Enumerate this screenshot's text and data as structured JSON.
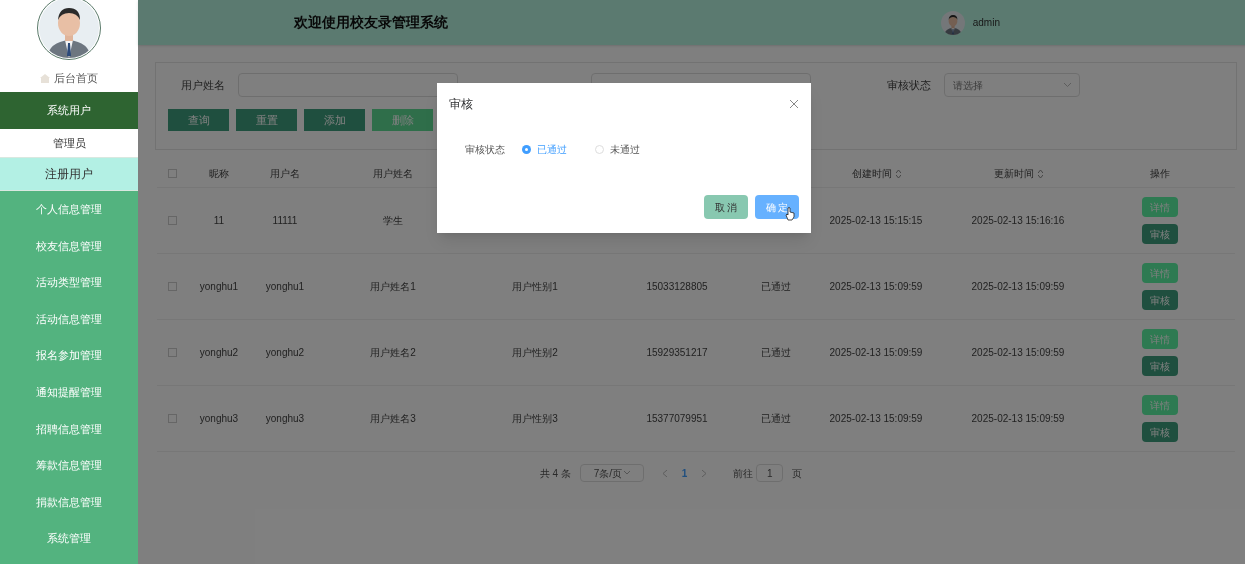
{
  "sidebar": {
    "home": "后台首页",
    "menu": [
      {
        "label": "系统用户",
        "expanded": true,
        "children": [
          {
            "label": "管理员",
            "selected": false
          },
          {
            "label": "注册用户",
            "selected": true
          }
        ]
      },
      {
        "label": "个人信息管理",
        "expanded": false
      },
      {
        "label": "校友信息管理",
        "expanded": false
      },
      {
        "label": "活动类型管理",
        "expanded": false
      },
      {
        "label": "活动信息管理",
        "expanded": false
      },
      {
        "label": "报名参加管理",
        "expanded": false
      },
      {
        "label": "通知提醒管理",
        "expanded": false
      },
      {
        "label": "招聘信息管理",
        "expanded": false
      },
      {
        "label": "筹款信息管理",
        "expanded": false
      },
      {
        "label": "捐款信息管理",
        "expanded": false
      },
      {
        "label": "系统管理",
        "expanded": false
      }
    ]
  },
  "header": {
    "title": "欢迎使用校友录管理系统",
    "user": "admin"
  },
  "filters": {
    "fields": [
      {
        "kind": "text",
        "label": "用户姓名"
      },
      {
        "kind": "text"
      },
      {
        "kind": "select",
        "label": "审核状态",
        "placeholder": "请选择"
      }
    ],
    "buttons": [
      {
        "label": "查询",
        "kind": "plain"
      },
      {
        "label": "重置",
        "kind": "plain"
      },
      {
        "label": "添加",
        "kind": "plain"
      },
      {
        "label": "删除",
        "kind": "danger"
      }
    ]
  },
  "table": {
    "all_checked": false,
    "columns": [
      {
        "label": "昵称"
      },
      {
        "label": "用户名"
      },
      {
        "label": "用户姓名"
      },
      {},
      {},
      {},
      {
        "label": "创建时间",
        "sortable": true
      },
      {
        "label": "更新时间",
        "sortable": true
      },
      {
        "label": "操作"
      }
    ],
    "rows": [
      {
        "checked": false,
        "cells": [
          {
            "text": "11"
          },
          {
            "text": "11111"
          },
          {
            "text": "学生"
          },
          {},
          {},
          {},
          {
            "text": "2025-02-13 15:15:15"
          },
          {
            "text": "2025-02-13 15:16:16"
          }
        ],
        "actions": [
          "详情",
          "审核"
        ]
      },
      {
        "checked": false,
        "cells": [
          {
            "text": "yonghu1"
          },
          {
            "text": "yonghu1"
          },
          {
            "text": "用户姓名1"
          },
          {
            "text": "用户性别1"
          },
          {
            "text": "15033128805"
          },
          {
            "text": "已通过"
          },
          {
            "text": "2025-02-13 15:09:59"
          },
          {
            "text": "2025-02-13 15:09:59"
          }
        ],
        "actions": [
          "详情",
          "审核"
        ]
      },
      {
        "checked": false,
        "cells": [
          {
            "text": "yonghu2"
          },
          {
            "text": "yonghu2"
          },
          {
            "text": "用户姓名2"
          },
          {
            "text": "用户性别2"
          },
          {
            "text": "15929351217"
          },
          {
            "text": "已通过"
          },
          {
            "text": "2025-02-13 15:09:59"
          },
          {
            "text": "2025-02-13 15:09:59"
          }
        ],
        "actions": [
          "详情",
          "审核"
        ]
      },
      {
        "checked": false,
        "cells": [
          {
            "text": "yonghu3"
          },
          {
            "text": "yonghu3"
          },
          {
            "text": "用户姓名3"
          },
          {
            "text": "用户性别3"
          },
          {
            "text": "15377079951"
          },
          {
            "text": "已通过"
          },
          {
            "text": "2025-02-13 15:09:59"
          },
          {
            "text": "2025-02-13 15:09:59"
          }
        ],
        "actions": [
          "详情",
          "审核"
        ]
      }
    ]
  },
  "pagination": {
    "total": "共 4 条",
    "page_size": "7条/页",
    "pages": [
      {
        "label": "1",
        "selected": true
      }
    ],
    "goto_label": "前往",
    "goto_value": "1",
    "goto_suffix": "页"
  },
  "dialog": {
    "title": "审核",
    "field_label": "审核状态",
    "options": [
      {
        "label": "已通过",
        "selected": true
      },
      {
        "label": "未通过",
        "selected": false
      }
    ],
    "cancel": "取 消",
    "confirm": "确 定"
  }
}
